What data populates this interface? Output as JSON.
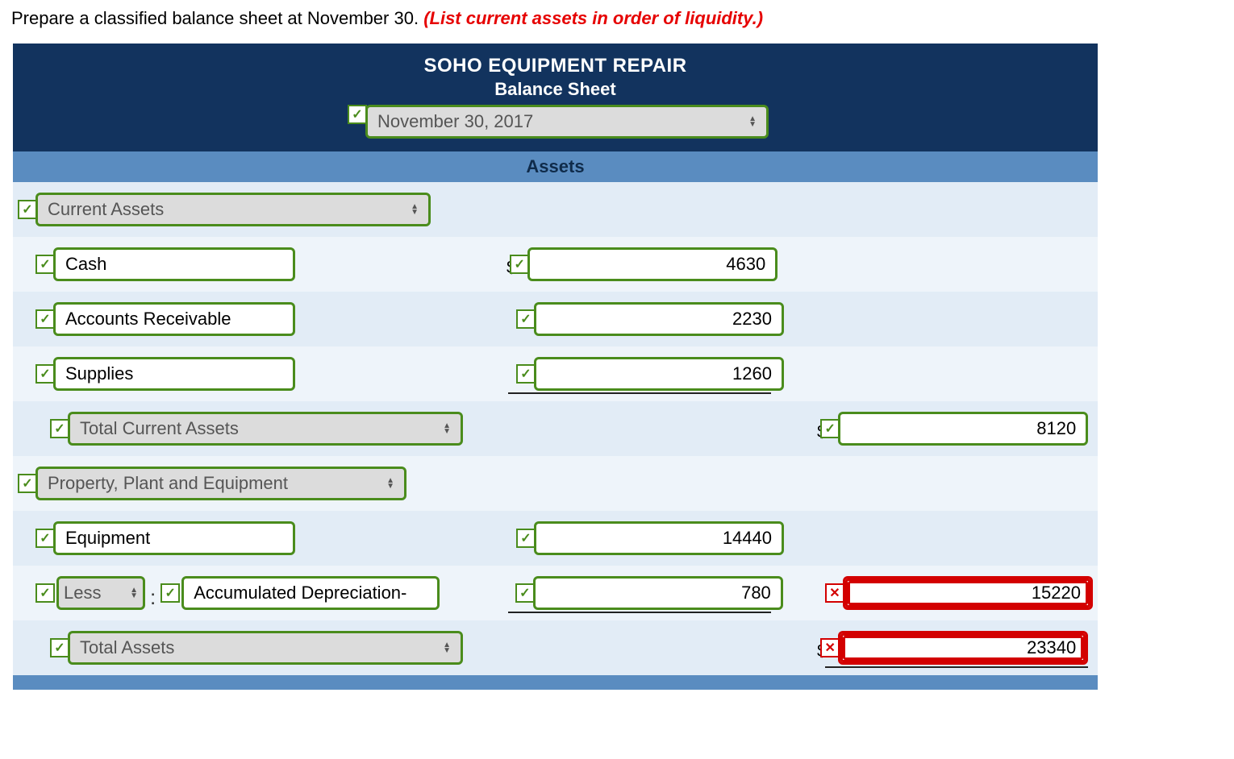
{
  "instruction": {
    "text": "Prepare a classified balance sheet at November 30. ",
    "hint": "(List current assets in order of liquidity.)"
  },
  "header": {
    "company": "SOHO EQUIPMENT REPAIR",
    "title": "Balance Sheet",
    "date": "November 30, 2017"
  },
  "section_assets": "Assets",
  "rows": {
    "current_assets_label": "Current Assets",
    "cash_label": "Cash",
    "cash_value": "4630",
    "ar_label": "Accounts Receivable",
    "ar_value": "2230",
    "supplies_label": "Supplies",
    "supplies_value": "1260",
    "total_current_label": "Total Current Assets",
    "total_current_value": "8120",
    "ppe_label": "Property, Plant and Equipment",
    "equipment_label": "Equipment",
    "equipment_value": "14440",
    "less_label": "Less",
    "accdep_label": "Accumulated Depreciation-",
    "accdep_value": "780",
    "ppe_net_value": "15220",
    "total_assets_label": "Total Assets",
    "total_assets_value": "23340"
  },
  "currency": "$"
}
